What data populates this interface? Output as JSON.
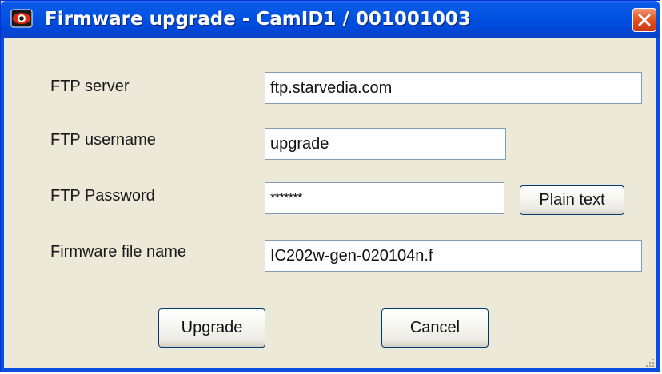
{
  "window": {
    "title": "Firmware upgrade - CamID1 / 001001003",
    "icon": "camera-eye-icon",
    "close_icon": "close-icon"
  },
  "form": {
    "ftp_server": {
      "label": "FTP server",
      "value": "ftp.starvedia.com"
    },
    "ftp_username": {
      "label": "FTP username",
      "value": "upgrade"
    },
    "ftp_password": {
      "label": "FTP Password",
      "value": "*******",
      "toggle_label": "Plain text"
    },
    "firmware_file": {
      "label": "Firmware file name",
      "value": "IC202w-gen-020104n.f"
    }
  },
  "buttons": {
    "upgrade": "Upgrade",
    "cancel": "Cancel"
  },
  "colors": {
    "titlebar": "#0154e3",
    "dialog_bg": "#ece9d8",
    "close_button": "#d9461a",
    "input_border": "#7f9db9",
    "button_border": "#003c74"
  }
}
